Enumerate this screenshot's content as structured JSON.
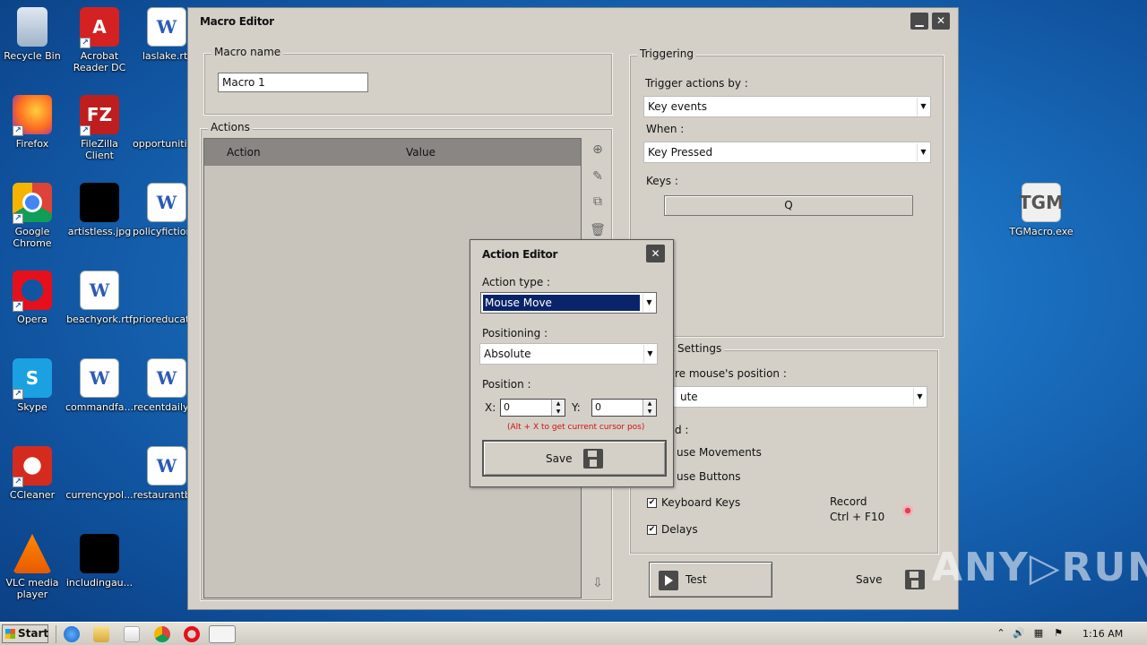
{
  "desktop": {
    "icons": [
      {
        "label": "Recycle Bin",
        "glyph": ""
      },
      {
        "label": "Acrobat Reader DC",
        "glyph": "A"
      },
      {
        "label": "laslake.rtf",
        "glyph": "W"
      },
      {
        "label": "Firefox",
        "glyph": ""
      },
      {
        "label": "FileZilla Client",
        "glyph": "FZ"
      },
      {
        "label": "opportunitie...",
        "glyph": ""
      },
      {
        "label": "Google Chrome",
        "glyph": ""
      },
      {
        "label": "artistless.jpg",
        "glyph": ""
      },
      {
        "label": "policyfiction...",
        "glyph": "W"
      },
      {
        "label": "Opera",
        "glyph": ""
      },
      {
        "label": "beachyork.rtf",
        "glyph": "W"
      },
      {
        "label": "prioreducati...",
        "glyph": ""
      },
      {
        "label": "Skype",
        "glyph": "S"
      },
      {
        "label": "commandfa...",
        "glyph": "W"
      },
      {
        "label": "recentdaily....",
        "glyph": "W"
      },
      {
        "label": "CCleaner",
        "glyph": ""
      },
      {
        "label": "currencypol...",
        "glyph": ""
      },
      {
        "label": "restaurantb...",
        "glyph": "W"
      },
      {
        "label": "VLC media player",
        "glyph": ""
      },
      {
        "label": "includingau...",
        "glyph": ""
      },
      {
        "label": "TGMacro.exe",
        "glyph": "TGM"
      }
    ]
  },
  "macro_editor": {
    "title": "Macro Editor",
    "minimize_glyph": "▁",
    "close_glyph": "✕",
    "macro_name_group": "Macro name",
    "macro_name_value": "Macro 1",
    "actions_group": "Actions",
    "columns": {
      "action": "Action",
      "value": "Value"
    },
    "tools": {
      "add": "⊕",
      "edit": "✎",
      "duplicate": "⧉",
      "delete": "🗑",
      "import": "⇩"
    },
    "triggering": {
      "group": "Triggering",
      "trigger_by_label": "Trigger actions by :",
      "trigger_by_value": "Key events",
      "when_label": "When :",
      "when_value": "Key Pressed",
      "keys_label": "Keys :",
      "keys_value": "Q"
    },
    "settings": {
      "group": "Settings",
      "mouse_position_label": "re mouse's position :",
      "mouse_position_value": "ute",
      "record_label": "d :",
      "mouse_movements": "use Movements",
      "mouse_buttons": "use Buttons",
      "keyboard_keys": "Keyboard Keys",
      "delays": "Delays",
      "keyboard_checked": "✔",
      "delays_checked": "✔",
      "record_text": "Record",
      "record_shortcut": "Ctrl + F10"
    },
    "test_label": "Test",
    "save_label": "Save"
  },
  "action_editor": {
    "title": "Action Editor",
    "close_glyph": "✕",
    "action_type_label": "Action type :",
    "action_type_value": "Mouse Move",
    "positioning_label": "Positioning :",
    "positioning_value": "Absolute",
    "position_label": "Position :",
    "x_label": "X:",
    "x_value": "0",
    "y_label": "Y:",
    "y_value": "0",
    "hint": "(Alt + X to get current cursor pos)",
    "save_label": "Save"
  },
  "taskbar": {
    "start_label": "Start",
    "time": "1:16 AM"
  },
  "watermark": "ANY▷RUN",
  "colors": {
    "selection": "#0a246a",
    "hint_red": "#d01010",
    "window_bg": "#d4d0c8"
  }
}
